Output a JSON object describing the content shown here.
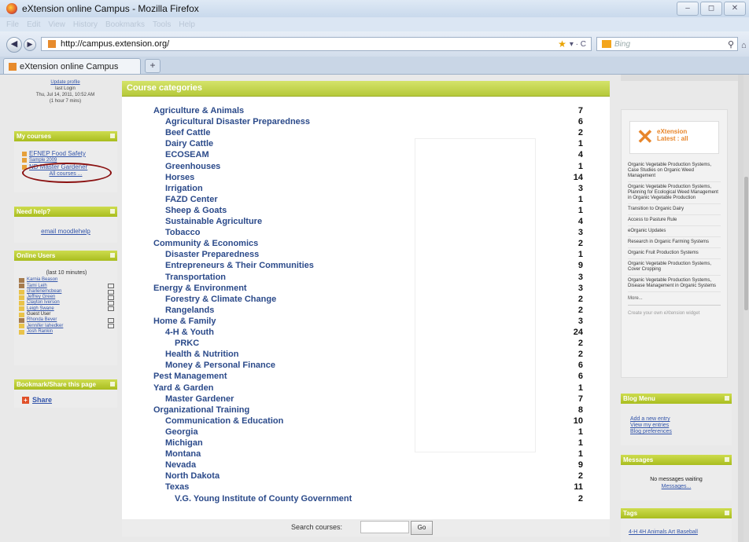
{
  "window": {
    "title": "eXtension online Campus - Mozilla Firefox",
    "controls": [
      "–",
      "◻",
      "✕"
    ]
  },
  "menubar": [
    "File",
    "Edit",
    "View",
    "History",
    "Bookmarks",
    "Tools",
    "Help"
  ],
  "navbar": {
    "url": "http://campus.extension.org/",
    "search_placeholder": "Bing"
  },
  "tabs": [
    {
      "label": "eXtension online Campus"
    }
  ],
  "left": {
    "profile": {
      "update": "Update profile",
      "last_login_label": "last Login",
      "last_login": "Thu, Jul 14, 2011, 10:52 AM",
      "ago": "(1 hour 7 mins)"
    },
    "my_courses": {
      "title": "My courses",
      "items": [
        "EFNEP Food Safety",
        "Sample 2009",
        "ND Master Gardener"
      ],
      "all": "All courses ..."
    },
    "need_help": {
      "title": "Need help?",
      "link": "email moodlehelp"
    },
    "online_users": {
      "title": "Online Users",
      "subtitle": "(last 10 minutes)",
      "users": [
        "Karnia Beason",
        "Tami Leih",
        "charlenemcbean",
        "Jeffrey Green",
        "Clayton Iverson",
        "Leigh Swane",
        "Guest User",
        "Rhonda Bever",
        "Jennifer Iahedker",
        "Josh Rankin"
      ]
    },
    "bookmark": {
      "title": "Bookmark/Share this page",
      "share": "Share"
    }
  },
  "main": {
    "title": "Course categories",
    "categories": [
      {
        "name": "Agriculture & Animals",
        "count": "7",
        "level": 0
      },
      {
        "name": "Agricultural Disaster Preparedness",
        "count": "6",
        "level": 1
      },
      {
        "name": "Beef Cattle",
        "count": "2",
        "level": 1
      },
      {
        "name": "Dairy Cattle",
        "count": "1",
        "level": 1
      },
      {
        "name": "ECOSEAM",
        "count": "4",
        "level": 1
      },
      {
        "name": "Greenhouses",
        "count": "1",
        "level": 1
      },
      {
        "name": "Horses",
        "count": "14",
        "level": 1
      },
      {
        "name": "Irrigation",
        "count": "3",
        "level": 1
      },
      {
        "name": "FAZD Center",
        "count": "1",
        "level": 1
      },
      {
        "name": "Sheep & Goats",
        "count": "1",
        "level": 1
      },
      {
        "name": "Sustainable Agriculture",
        "count": "4",
        "level": 1
      },
      {
        "name": "Tobacco",
        "count": "3",
        "level": 1
      },
      {
        "name": "Community & Economics",
        "count": "2",
        "level": 0
      },
      {
        "name": "Disaster Preparedness",
        "count": "1",
        "level": 1
      },
      {
        "name": "Entrepreneurs & Their Communities",
        "count": "9",
        "level": 1
      },
      {
        "name": "Transportation",
        "count": "3",
        "level": 1
      },
      {
        "name": "Energy & Environment",
        "count": "3",
        "level": 0
      },
      {
        "name": "Forestry & Climate Change",
        "count": "2",
        "level": 1
      },
      {
        "name": "Rangelands",
        "count": "2",
        "level": 1
      },
      {
        "name": "Home & Family",
        "count": "3",
        "level": 0
      },
      {
        "name": "4-H & Youth",
        "count": "24",
        "level": 1
      },
      {
        "name": "PRKC",
        "count": "2",
        "level": 2
      },
      {
        "name": "Health & Nutrition",
        "count": "2",
        "level": 1
      },
      {
        "name": "Money & Personal Finance",
        "count": "6",
        "level": 1
      },
      {
        "name": "Pest Management",
        "count": "6",
        "level": 0
      },
      {
        "name": "Yard & Garden",
        "count": "1",
        "level": 0
      },
      {
        "name": "Master Gardener",
        "count": "7",
        "level": 1
      },
      {
        "name": "Organizational Training",
        "count": "8",
        "level": 0
      },
      {
        "name": "Communication & Education",
        "count": "10",
        "level": 1
      },
      {
        "name": "Georgia",
        "count": "1",
        "level": 1
      },
      {
        "name": "Michigan",
        "count": "1",
        "level": 1
      },
      {
        "name": "Montana",
        "count": "1",
        "level": 1
      },
      {
        "name": "Nevada",
        "count": "9",
        "level": 1
      },
      {
        "name": "North Dakota",
        "count": "2",
        "level": 1
      },
      {
        "name": "Texas",
        "count": "11",
        "level": 1
      },
      {
        "name": "V.G. Young Institute of County Government",
        "count": "2",
        "level": 2
      }
    ],
    "search_label": "Search courses:",
    "search_button": "Go"
  },
  "right": {
    "latest": {
      "brand": "eXtension",
      "subtitle": "Latest : all",
      "items": [
        "Organic Vegetable Production Systems, Case Studies on Organic Weed Management",
        "Organic Vegetable Production Systems, Planning for Ecological Weed Management in Organic Vegetable Production",
        "Transition to Organic Dairy",
        "Access to Pasture Rule",
        "eOrganic Updates",
        "Research in Organic Farming Systems",
        "Organic Fruit Production Systems",
        "Organic Vegetable Production Systems, Cover Cropping",
        "Organic Vegetable Production Systems, Disease Management in Organic Systems"
      ],
      "more": "More...",
      "create": "Create your own eXtension widget"
    },
    "blog_menu": {
      "title": "Blog Menu",
      "links": [
        "Add a new entry",
        "View my entries",
        "Blog preferences"
      ]
    },
    "messages": {
      "title": "Messages",
      "text": "No messages waiting",
      "link": "Messages..."
    },
    "tags": {
      "title": "Tags",
      "text": "4-H 4H Animals Art Baseball"
    }
  }
}
